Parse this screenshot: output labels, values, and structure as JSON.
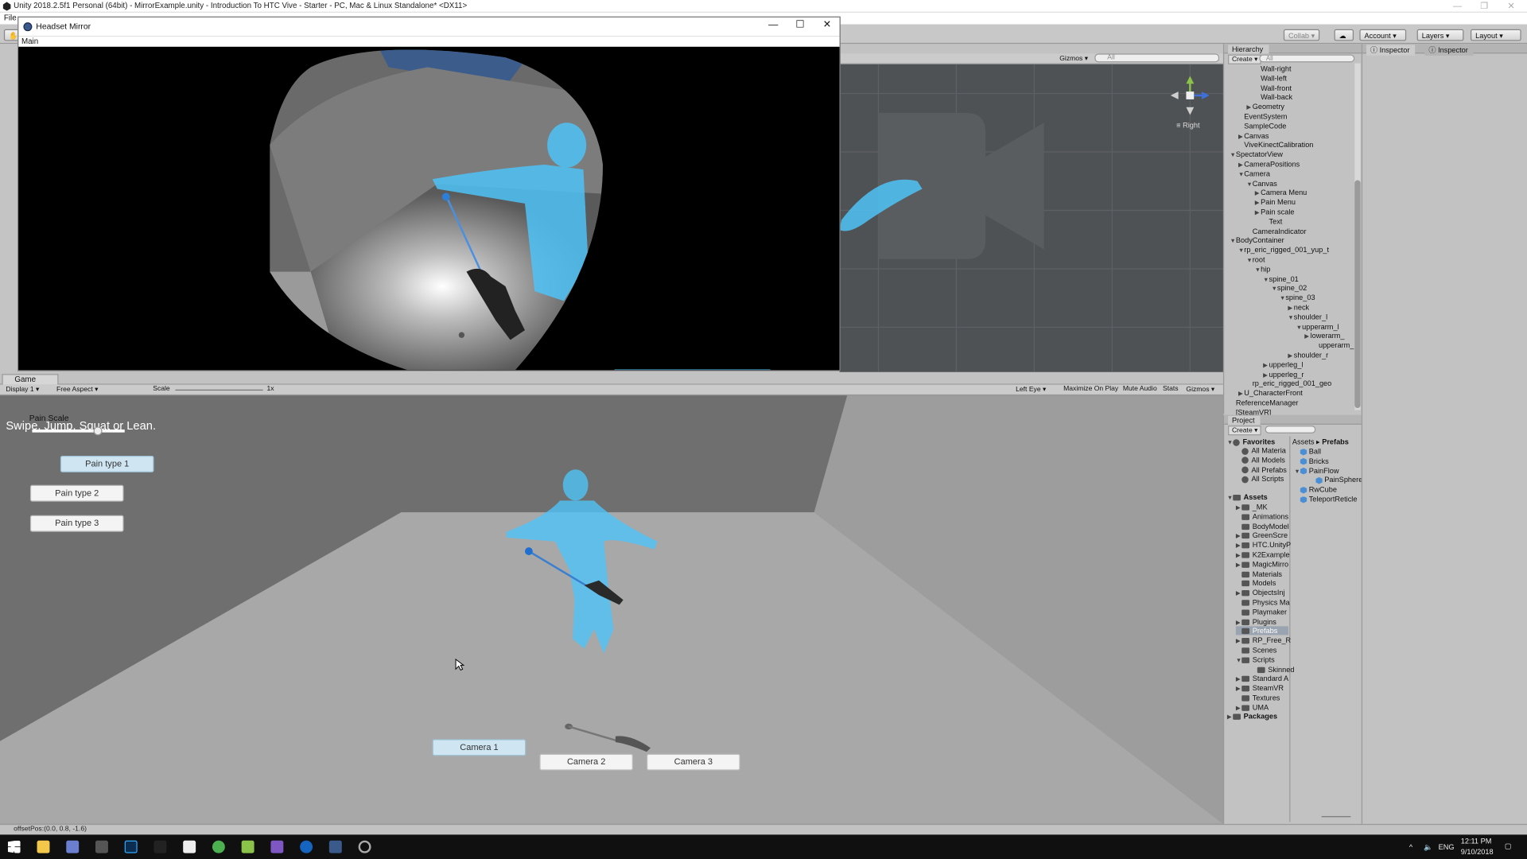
{
  "window_title": "Unity 2018.2.5f1 Personal (64bit) - MirrorExample.unity - Introduction To HTC Vive - Starter - PC, Mac & Linux Standalone* <DX11>",
  "menu_first": "File",
  "toolbar": {
    "collab": "Collab",
    "account": "Account",
    "layers": "Layers",
    "layout": "Layout"
  },
  "scene": {
    "gizmos": "Gizmos",
    "search_placeholder": "All",
    "view_label": "Right"
  },
  "mirror": {
    "title": "Headset Mirror",
    "menu": "Main"
  },
  "game": {
    "tab": "Game",
    "display": "Display 1",
    "aspect": "Free Aspect",
    "scale_label": "Scale",
    "scale_value": "1x",
    "eye": "Left Eye",
    "maximize": "Maximize On Play",
    "mute": "Mute Audio",
    "stats": "Stats",
    "gizmos": "Gizmos",
    "instruction": "Swipe, Jump, Squat or Lean.",
    "pain_scale_label": "Pain Scale",
    "pain_scale_value": 0.7,
    "pain_buttons": [
      "Pain type 1",
      "Pain type 2",
      "Pain type 3"
    ],
    "camera_buttons": [
      "Camera 1",
      "Camera 2",
      "Camera 3"
    ]
  },
  "hierarchy": {
    "title": "Hierarchy",
    "create": "Create",
    "search_placeholder": "All",
    "rows": [
      {
        "label": "Wall-right",
        "indent": 3,
        "arrow": ""
      },
      {
        "label": "Wall-left",
        "indent": 3,
        "arrow": ""
      },
      {
        "label": "Wall-front",
        "indent": 3,
        "arrow": ""
      },
      {
        "label": "Wall-back",
        "indent": 3,
        "arrow": ""
      },
      {
        "label": "Geometry",
        "indent": 2,
        "arrow": "▶"
      },
      {
        "label": "EventSystem",
        "indent": 1,
        "arrow": ""
      },
      {
        "label": "SampleCode",
        "indent": 1,
        "arrow": ""
      },
      {
        "label": "Canvas",
        "indent": 1,
        "arrow": "▶"
      },
      {
        "label": "ViveKinectCalibration",
        "indent": 1,
        "arrow": ""
      },
      {
        "label": "SpectatorView",
        "indent": 0,
        "arrow": "▼"
      },
      {
        "label": "CameraPositions",
        "indent": 1,
        "arrow": "▶"
      },
      {
        "label": "Camera",
        "indent": 1,
        "arrow": "▼"
      },
      {
        "label": "Canvas",
        "indent": 2,
        "arrow": "▼"
      },
      {
        "label": "Camera Menu",
        "indent": 3,
        "arrow": "▶"
      },
      {
        "label": "Pain Menu",
        "indent": 3,
        "arrow": "▶"
      },
      {
        "label": "Pain scale",
        "indent": 3,
        "arrow": "▶"
      },
      {
        "label": "Text",
        "indent": 4,
        "arrow": ""
      },
      {
        "label": "CameraIndicator",
        "indent": 2,
        "arrow": ""
      },
      {
        "label": "BodyContainer",
        "indent": 0,
        "arrow": "▼"
      },
      {
        "label": "rp_eric_rigged_001_yup_t",
        "indent": 1,
        "arrow": "▼"
      },
      {
        "label": "root",
        "indent": 2,
        "arrow": "▼"
      },
      {
        "label": "hip",
        "indent": 3,
        "arrow": "▼"
      },
      {
        "label": "spine_01",
        "indent": 4,
        "arrow": "▼"
      },
      {
        "label": "spine_02",
        "indent": 5,
        "arrow": "▼"
      },
      {
        "label": "spine_03",
        "indent": 6,
        "arrow": "▼"
      },
      {
        "label": "neck",
        "indent": 7,
        "arrow": "▶"
      },
      {
        "label": "shoulder_l",
        "indent": 7,
        "arrow": "▼"
      },
      {
        "label": "upperarm_l",
        "indent": 8,
        "arrow": "▼"
      },
      {
        "label": "lowerarm_",
        "indent": 9,
        "arrow": "▶"
      },
      {
        "label": "upperarm_",
        "indent": 10,
        "arrow": ""
      },
      {
        "label": "shoulder_r",
        "indent": 7,
        "arrow": "▶"
      },
      {
        "label": "upperleg_l",
        "indent": 4,
        "arrow": "▶"
      },
      {
        "label": "upperleg_r",
        "indent": 4,
        "arrow": "▶"
      },
      {
        "label": "rp_eric_rigged_001_geo",
        "indent": 2,
        "arrow": ""
      },
      {
        "label": "U_CharacterFront",
        "indent": 1,
        "arrow": "▶"
      },
      {
        "label": "ReferenceManager",
        "indent": 0,
        "arrow": ""
      },
      {
        "label": "[SteamVR]",
        "indent": 0,
        "arrow": ""
      }
    ]
  },
  "project": {
    "title": "Project",
    "create": "Create",
    "favorites_label": "Favorites",
    "favorites": [
      "All Materia",
      "All Models",
      "All Prefabs",
      "All Scripts"
    ],
    "assets_label": "Assets",
    "folders": [
      {
        "label": "_MK",
        "arrow": "▶"
      },
      {
        "label": "Animations",
        "arrow": ""
      },
      {
        "label": "BodyModel",
        "arrow": ""
      },
      {
        "label": "GreenScre",
        "arrow": "▶"
      },
      {
        "label": "HTC.UnityP",
        "arrow": "▶"
      },
      {
        "label": "K2Example",
        "arrow": "▶"
      },
      {
        "label": "MagicMirro",
        "arrow": "▶"
      },
      {
        "label": "Materials",
        "arrow": ""
      },
      {
        "label": "Models",
        "arrow": ""
      },
      {
        "label": "ObjectsInj",
        "arrow": "▶"
      },
      {
        "label": "Physics Ma",
        "arrow": ""
      },
      {
        "label": "Playmaker",
        "arrow": ""
      },
      {
        "label": "Plugins",
        "arrow": "▶"
      },
      {
        "label": "Prefabs",
        "arrow": ""
      },
      {
        "label": "RP_Free_R",
        "arrow": "▶"
      },
      {
        "label": "Scenes",
        "arrow": ""
      },
      {
        "label": "Scripts",
        "arrow": "▼"
      },
      {
        "label": "Skinned",
        "arrow": ""
      },
      {
        "label": "Standard A",
        "arrow": "▶"
      },
      {
        "label": "SteamVR",
        "arrow": "▶"
      },
      {
        "label": "Textures",
        "arrow": ""
      },
      {
        "label": "UMA",
        "arrow": "▶"
      }
    ],
    "packages_label": "Packages",
    "breadcrumb_root": "Assets",
    "breadcrumb_sep": "▸",
    "breadcrumb_leaf": "Prefabs",
    "prefabs": [
      {
        "label": "Ball",
        "arrow": ""
      },
      {
        "label": "Bricks",
        "arrow": ""
      },
      {
        "label": "PainFlow",
        "arrow": "▼"
      },
      {
        "label": "PainSphere",
        "arrow": ""
      },
      {
        "label": "RwCube",
        "arrow": ""
      },
      {
        "label": "TeleportReticle",
        "arrow": ""
      }
    ]
  },
  "inspector": {
    "tab1": "Inspector",
    "tab2": "Inspector"
  },
  "status": "offsetPos:(0.0, 0.8, -1.6)",
  "taskbar": {
    "lang": "ENG",
    "time": "12:11 PM",
    "date": "9/10/2018"
  },
  "colors": {
    "hologram": "#4fc3f7",
    "selection": "#cfe6f2",
    "editor_bg": "#c2c2c2"
  }
}
